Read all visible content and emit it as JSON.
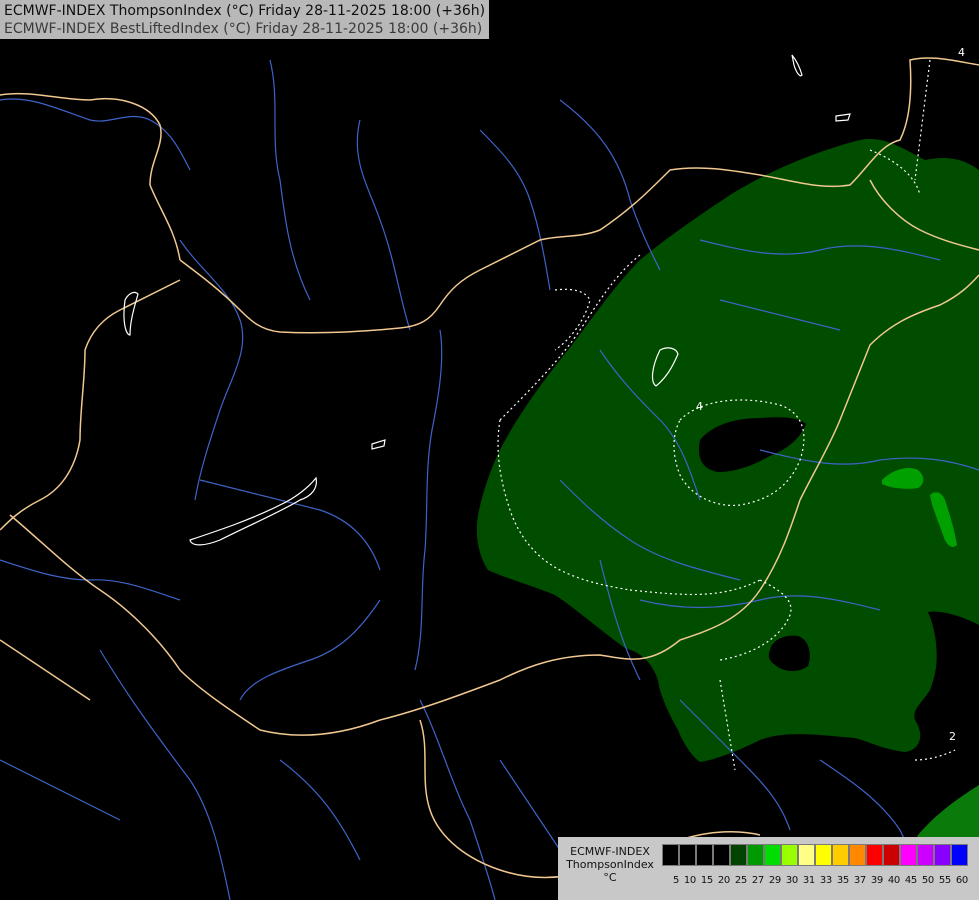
{
  "header": {
    "title_line1": "ECMWF-INDEX ThompsonIndex (°C) Friday 28-11-2025 18:00 (+36h)",
    "title_line2": "ECMWF-INDEX BestLiftedIndex (°C) Friday 28-11-2025 18:00 (+36h)"
  },
  "legend": {
    "model": "ECMWF-INDEX",
    "parameter": "ThompsonIndex",
    "unit": "°C",
    "swatch_colors": [
      "#000000",
      "#000000",
      "#000000",
      "#000000",
      "#004400",
      "#009900",
      "#00dd00",
      "#99ff00",
      "#ffff88",
      "#ffff00",
      "#ffcc00",
      "#ff8800",
      "#ff0000",
      "#cc0000",
      "#ff00ff",
      "#cc00ff",
      "#8800ff",
      "#0000ff"
    ],
    "ticks": [
      "5",
      "10",
      "15",
      "20",
      "25",
      "27",
      "29",
      "30",
      "31",
      "33",
      "35",
      "37",
      "39",
      "40",
      "45",
      "50",
      "55",
      "60"
    ]
  },
  "map_labels": {
    "contour_top_right": "4",
    "contour_center": "4",
    "contour_bottom_right": "2"
  },
  "colors": {
    "fill_dark_green": "#004d00",
    "fill_bright_green": "#00a000",
    "fill_medium_green": "#0a7a0a",
    "border": "#f0c890",
    "river": "#3f63c8",
    "contour": "#ffffff",
    "background": "#000000"
  }
}
